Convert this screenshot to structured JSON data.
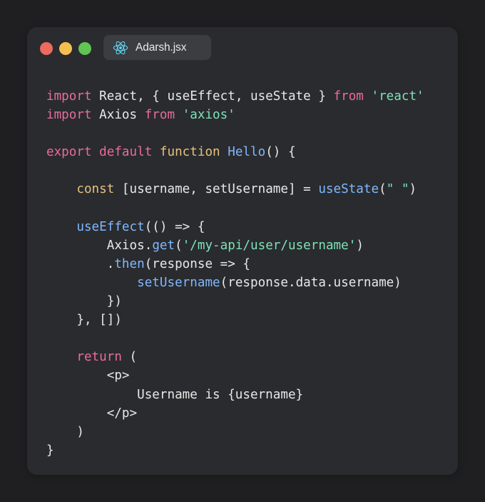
{
  "window": {
    "file_tab": {
      "label": "Adarsh.jsx",
      "icon": "react-icon",
      "icon_color": "#61dafb"
    },
    "traffic_lights": {
      "close_color": "#ed6a5e",
      "minimize_color": "#f5bf4f",
      "maximize_color": "#61c554"
    }
  },
  "theme": {
    "keyword": "#e86ca0",
    "string": "#7ee2b8",
    "function_name": "#e7c27d",
    "method": "#7fb8ff",
    "text": "#e8e8e8",
    "background": "#2a2b2e"
  },
  "code_lines": [
    {
      "tokens": [
        {
          "text": "import",
          "kind": "keyword"
        },
        {
          "text": " React, { useEffect, useState } ",
          "kind": "text"
        },
        {
          "text": "from",
          "kind": "keyword"
        },
        {
          "text": " ",
          "kind": "text"
        },
        {
          "text": "'react'",
          "kind": "string"
        }
      ]
    },
    {
      "tokens": [
        {
          "text": "import",
          "kind": "keyword"
        },
        {
          "text": " Axios ",
          "kind": "text"
        },
        {
          "text": "from",
          "kind": "keyword"
        },
        {
          "text": " ",
          "kind": "text"
        },
        {
          "text": "'axios'",
          "kind": "string"
        }
      ]
    },
    {
      "tokens": []
    },
    {
      "tokens": [
        {
          "text": "export",
          "kind": "keyword"
        },
        {
          "text": " ",
          "kind": "text"
        },
        {
          "text": "default",
          "kind": "keyword"
        },
        {
          "text": " ",
          "kind": "text"
        },
        {
          "text": "function",
          "kind": "function_name"
        },
        {
          "text": " ",
          "kind": "text"
        },
        {
          "text": "Hello",
          "kind": "method"
        },
        {
          "text": "() {",
          "kind": "text"
        }
      ]
    },
    {
      "tokens": []
    },
    {
      "indent": "    ",
      "tokens": [
        {
          "text": "const",
          "kind": "function_name"
        },
        {
          "text": " [username, setUsername] = ",
          "kind": "text"
        },
        {
          "text": "useState",
          "kind": "method"
        },
        {
          "text": "(",
          "kind": "text"
        },
        {
          "text": "\" \"",
          "kind": "string"
        },
        {
          "text": ")",
          "kind": "text"
        }
      ]
    },
    {
      "tokens": []
    },
    {
      "indent": "    ",
      "tokens": [
        {
          "text": "useEffect",
          "kind": "method"
        },
        {
          "text": "(() => {",
          "kind": "text"
        }
      ]
    },
    {
      "indent": "        ",
      "tokens": [
        {
          "text": "Axios.",
          "kind": "text"
        },
        {
          "text": "get",
          "kind": "method"
        },
        {
          "text": "(",
          "kind": "text"
        },
        {
          "text": "'/my-api/user/username'",
          "kind": "string"
        },
        {
          "text": ")",
          "kind": "text"
        }
      ]
    },
    {
      "indent": "        ",
      "tokens": [
        {
          "text": ".",
          "kind": "text"
        },
        {
          "text": "then",
          "kind": "method"
        },
        {
          "text": "(response => {",
          "kind": "text"
        }
      ]
    },
    {
      "indent": "            ",
      "tokens": [
        {
          "text": "setUsername",
          "kind": "method"
        },
        {
          "text": "(response.data.username)",
          "kind": "text"
        }
      ]
    },
    {
      "indent": "        ",
      "tokens": [
        {
          "text": "})",
          "kind": "text"
        }
      ]
    },
    {
      "indent": "    ",
      "tokens": [
        {
          "text": "}, [])",
          "kind": "text"
        }
      ]
    },
    {
      "tokens": []
    },
    {
      "indent": "    ",
      "tokens": [
        {
          "text": "return",
          "kind": "keyword"
        },
        {
          "text": " (",
          "kind": "text"
        }
      ]
    },
    {
      "indent": "        ",
      "tokens": [
        {
          "text": "<p>",
          "kind": "text"
        }
      ]
    },
    {
      "indent": "            ",
      "tokens": [
        {
          "text": "Username is {username}",
          "kind": "text"
        }
      ]
    },
    {
      "indent": "        ",
      "tokens": [
        {
          "text": "</p>",
          "kind": "text"
        }
      ]
    },
    {
      "indent": "    ",
      "tokens": [
        {
          "text": ")",
          "kind": "text"
        }
      ]
    },
    {
      "tokens": [
        {
          "text": "}",
          "kind": "text"
        }
      ]
    }
  ]
}
